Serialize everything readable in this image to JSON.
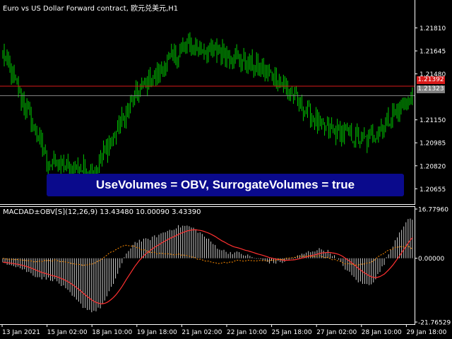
{
  "symbol_title": "Euro vs US Dollar Forward contract, 欧元兑美元,H1",
  "price_axis": {
    "ticks": [
      "1.21810",
      "1.21645",
      "1.21480",
      "1.21150",
      "1.20985",
      "1.20820",
      "1.20655"
    ],
    "bid_label": "1.21392",
    "current_label": "1.21323"
  },
  "banner": {
    "text": "UseVolumes = OBV, SurrogateVolumes = true"
  },
  "indicator_title": "MACDAD±OBV[S](12,26,9) 13.43480 10.00090 3.43390",
  "indicator_axis": {
    "max": "16.77960",
    "zero": "0.00000",
    "min": "-21.76529"
  },
  "time_axis": [
    "13 Jan 2021",
    "15 Jan 02:00",
    "18 Jan 10:00",
    "19 Jan 18:00",
    "21 Jan 02:00",
    "22 Jan 10:00",
    "25 Jan 18:00",
    "27 Jan 02:00",
    "28 Jan 10:00",
    "29 Jan 18:00"
  ],
  "colors": {
    "candle": "#00c800",
    "bid_line": "#d91a1a",
    "current_line": "#808080",
    "histogram": "#c8c8c8",
    "signal": "#ff3030",
    "banner_bg": "#0a0a8c"
  },
  "chart_data": [
    {
      "type": "line",
      "title": "Euro vs US Dollar Forward contract, 欧元兑美元,H1",
      "x": [
        "13 Jan 2021",
        "15 Jan 02:00",
        "18 Jan 10:00",
        "19 Jan 18:00",
        "21 Jan 02:00",
        "22 Jan 10:00",
        "25 Jan 18:00",
        "27 Jan 02:00",
        "28 Jan 10:00",
        "29 Jan 18:00"
      ],
      "close": [
        1.2163,
        1.2084,
        1.2078,
        1.2136,
        1.2168,
        1.2162,
        1.2145,
        1.211,
        1.21,
        1.2132
      ],
      "ylim": [
        1.2055,
        1.2198
      ],
      "hlines": [
        1.21392,
        1.21323
      ]
    },
    {
      "type": "bar",
      "title": "MACDAD±OBV[S](12,26,9) 13.43480 10.00090 3.43390",
      "x": [
        "13 Jan 2021",
        "15 Jan 02:00",
        "18 Jan 10:00",
        "19 Jan 18:00",
        "21 Jan 02:00",
        "22 Jan 10:00",
        "25 Jan 18:00",
        "27 Jan 02:00",
        "28 Jan 10:00",
        "29 Jan 18:00"
      ],
      "values": [
        -1.5,
        -7.0,
        -18.0,
        6.0,
        11.0,
        2.0,
        -1.5,
        3.0,
        -9.0,
        13.4
      ],
      "ylim": [
        -21.76529,
        16.7796
      ]
    }
  ]
}
